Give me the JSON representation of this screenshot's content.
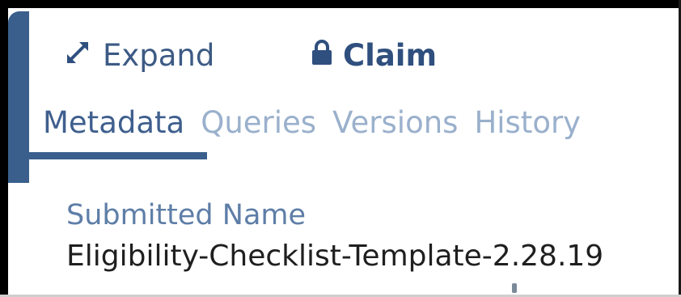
{
  "toolbar": {
    "expand_label": "Expand",
    "expand_icon": "expand-arrows-icon",
    "claim_label": "Claim",
    "claim_icon": "lock-icon"
  },
  "tabs": [
    {
      "label": "Metadata",
      "active": true
    },
    {
      "label": "Queries",
      "active": false
    },
    {
      "label": "Versions",
      "active": false
    },
    {
      "label": "History",
      "active": false
    }
  ],
  "metadata": {
    "submitted_name_label": "Submitted Name",
    "submitted_name_value": "Eligibility-Checklist-Template-2.28.19"
  },
  "colors": {
    "accent": "#3a5f8c",
    "tab_inactive": "#9ab0cc",
    "label": "#5e7ea7",
    "value": "#1f1f1f"
  }
}
